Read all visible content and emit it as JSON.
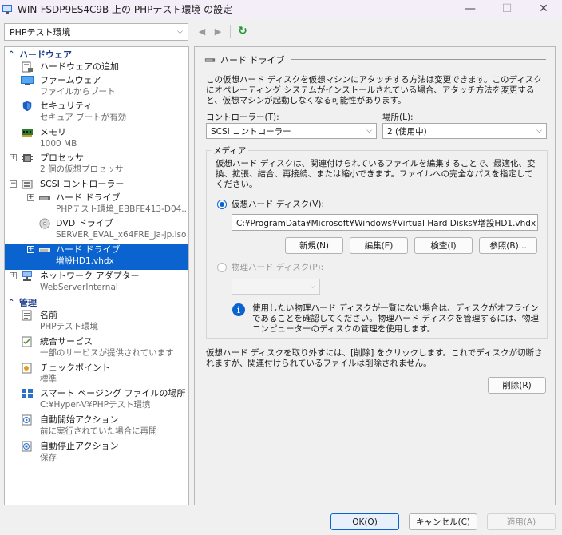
{
  "window": {
    "title": "WIN-FSDP9ES4C9B 上の PHPテスト環境 の設定",
    "minimize": "—",
    "maximize": "☐",
    "close": "✕"
  },
  "toolbar": {
    "vm_selected": "PHPテスト環境",
    "back": "◀",
    "forward": "▶",
    "refresh": "↻"
  },
  "tree": {
    "hardware_header": "ハードウェア",
    "management_header": "管理",
    "hardware": [
      {
        "line1": "ハードウェアの追加",
        "line2": ""
      },
      {
        "line1": "ファームウェア",
        "line2": "ファイルからブート"
      },
      {
        "line1": "セキュリティ",
        "line2": "セキュア ブートが有効"
      },
      {
        "line1": "メモリ",
        "line2": "1000 MB"
      },
      {
        "line1": "プロセッサ",
        "line2": "2 個の仮想プロセッサ"
      },
      {
        "line1": "SCSI コントローラー",
        "line2": ""
      },
      {
        "line1": "ハード ドライブ",
        "line2": "PHPテスト環境_EBBFE413-D04..."
      },
      {
        "line1": "DVD ドライブ",
        "line2": "SERVER_EVAL_x64FRE_ja-jp.iso"
      },
      {
        "line1": "ハード ドライブ",
        "line2": "増設HD1.vhdx"
      },
      {
        "line1": "ネットワーク アダプター",
        "line2": "WebServerInternal"
      }
    ],
    "management": [
      {
        "line1": "名前",
        "line2": "PHPテスト環境"
      },
      {
        "line1": "統合サービス",
        "line2": "一部のサービスが提供されています"
      },
      {
        "line1": "チェックポイント",
        "line2": "標準"
      },
      {
        "line1": "スマート ページング ファイルの場所",
        "line2": "C:¥Hyper-V¥PHPテスト環境"
      },
      {
        "line1": "自動開始アクション",
        "line2": "前に実行されていた場合に再開"
      },
      {
        "line1": "自動停止アクション",
        "line2": "保存"
      }
    ]
  },
  "panel": {
    "title": "ハード ドライブ",
    "description": "この仮想ハード ディスクを仮想マシンにアタッチする方法は変更できます。このディスクにオペレーティング システムがインストールされている場合、アタッチ方法を変更すると、仮想マシンが起動しなくなる可能性があります。",
    "controller_label": "コントローラー(T):",
    "controller_value": "SCSI コントローラー",
    "location_label": "場所(L):",
    "location_value": "2 (使用中)",
    "media_label": "メディア",
    "media_description": "仮想ハード ディスクは、関連付けられているファイルを編集することで、最適化、変換、拡張、結合、再接続、または縮小できます。ファイルへの完全なパスを指定してください。",
    "virtual_disk_label": "仮想ハード ディスク(V):",
    "virtual_disk_path": "C:¥ProgramData¥Microsoft¥Windows¥Virtual Hard Disks¥増設HD1.vhdx",
    "new_button": "新規(N)",
    "edit_button": "編集(E)",
    "inspect_button": "検査(I)",
    "browse_button": "参照(B)...",
    "physical_disk_label": "物理ハード ディスク(P):",
    "physical_disk_value": "",
    "info_text": "使用したい物理ハード ディスクが一覧にない場合は、ディスクがオフラインであることを確認してください。物理ハード ディスクを管理するには、物理コンピューターのディスクの管理を使用します。",
    "remove_description": "仮想ハード ディスクを取り外すには、[削除] をクリックします。これでディスクが切断されますが、関連付けられているファイルは削除されません。",
    "remove_button": "削除(R)"
  },
  "footer": {
    "ok": "OK(O)",
    "cancel": "キャンセル(C)",
    "apply": "適用(A)"
  },
  "colors": {
    "selection": "#0a63cf",
    "header_text": "#1c3c8c"
  }
}
